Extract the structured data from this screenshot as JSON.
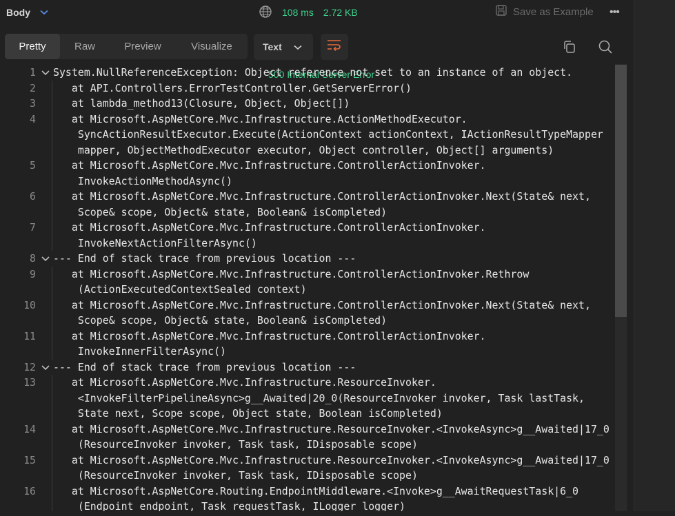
{
  "header": {
    "body_label": "Body",
    "status": "500 Internal Server Error",
    "time": "108 ms",
    "size": "2.72 KB",
    "save_example": "Save as Example",
    "more": "•••"
  },
  "view_tabs": [
    "Pretty",
    "Raw",
    "Preview",
    "Visualize"
  ],
  "active_tab": "Pretty",
  "format": "Text",
  "colors": {
    "status": "#3ed08c",
    "wrap_icon": "#e96b3b",
    "bg": "#212121"
  },
  "code": {
    "line_numbers": [
      "1",
      "2",
      "3",
      "4",
      "5",
      "6",
      "7",
      "8",
      "9",
      "10",
      "11",
      "12",
      "13",
      "14",
      "15",
      "16"
    ],
    "rows": [
      {
        "n": "1",
        "fold": true,
        "text": "System.NullReferenceException: Object reference not set to an instance of an object."
      },
      {
        "n": "2",
        "text": "   at API.Controllers.ErrorTestController.GetServerError()"
      },
      {
        "n": "3",
        "text": "   at lambda_method13(Closure, Object, Object[])"
      },
      {
        "n": "4",
        "text": "   at Microsoft.AspNetCore.Mvc.Infrastructure.ActionMethodExecutor."
      },
      {
        "n": "",
        "text": "    SyncActionResultExecutor.Execute(ActionContext actionContext, IActionResultTypeMapper"
      },
      {
        "n": "",
        "text": "    mapper, ObjectMethodExecutor executor, Object controller, Object[] arguments)"
      },
      {
        "n": "5",
        "text": "   at Microsoft.AspNetCore.Mvc.Infrastructure.ControllerActionInvoker."
      },
      {
        "n": "",
        "text": "    InvokeActionMethodAsync()"
      },
      {
        "n": "6",
        "text": "   at Microsoft.AspNetCore.Mvc.Infrastructure.ControllerActionInvoker.Next(State& next,"
      },
      {
        "n": "",
        "text": "    Scope& scope, Object& state, Boolean& isCompleted)"
      },
      {
        "n": "7",
        "text": "   at Microsoft.AspNetCore.Mvc.Infrastructure.ControllerActionInvoker."
      },
      {
        "n": "",
        "text": "    InvokeNextActionFilterAsync()"
      },
      {
        "n": "8",
        "fold": true,
        "text": "--- End of stack trace from previous location ---"
      },
      {
        "n": "9",
        "text": "   at Microsoft.AspNetCore.Mvc.Infrastructure.ControllerActionInvoker.Rethrow"
      },
      {
        "n": "",
        "text": "    (ActionExecutedContextSealed context)"
      },
      {
        "n": "10",
        "text": "   at Microsoft.AspNetCore.Mvc.Infrastructure.ControllerActionInvoker.Next(State& next,"
      },
      {
        "n": "",
        "text": "    Scope& scope, Object& state, Boolean& isCompleted)"
      },
      {
        "n": "11",
        "text": "   at Microsoft.AspNetCore.Mvc.Infrastructure.ControllerActionInvoker."
      },
      {
        "n": "",
        "text": "    InvokeInnerFilterAsync()"
      },
      {
        "n": "12",
        "fold": true,
        "text": "--- End of stack trace from previous location ---"
      },
      {
        "n": "13",
        "text": "   at Microsoft.AspNetCore.Mvc.Infrastructure.ResourceInvoker."
      },
      {
        "n": "",
        "text": "    <InvokeFilterPipelineAsync>g__Awaited|20_0(ResourceInvoker invoker, Task lastTask,"
      },
      {
        "n": "",
        "text": "    State next, Scope scope, Object state, Boolean isCompleted)"
      },
      {
        "n": "14",
        "text": "   at Microsoft.AspNetCore.Mvc.Infrastructure.ResourceInvoker.<InvokeAsync>g__Awaited|17_0"
      },
      {
        "n": "",
        "text": "    (ResourceInvoker invoker, Task task, IDisposable scope)"
      },
      {
        "n": "15",
        "text": "   at Microsoft.AspNetCore.Mvc.Infrastructure.ResourceInvoker.<InvokeAsync>g__Awaited|17_0"
      },
      {
        "n": "",
        "text": "    (ResourceInvoker invoker, Task task, IDisposable scope)"
      },
      {
        "n": "16",
        "text": "   at Microsoft.AspNetCore.Routing.EndpointMiddleware.<Invoke>g__AwaitRequestTask|6_0"
      },
      {
        "n": "",
        "text": "    (Endpoint endpoint, Task requestTask, ILogger logger)"
      }
    ]
  },
  "icons": {
    "body_chevron": "chevron-down-icon",
    "globe": "globe-icon",
    "save": "save-icon",
    "wrap": "word-wrap-icon",
    "copy": "copy-icon",
    "search": "search-icon",
    "fold": "fold-chevron-icon"
  }
}
